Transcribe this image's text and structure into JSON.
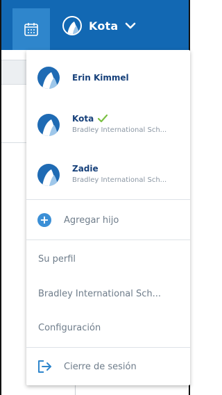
{
  "topbar": {
    "calendar_icon": "calendar-icon",
    "current_child": "Kota",
    "dropdown_icon": "chevron-down-icon"
  },
  "menu": {
    "children": [
      {
        "name": "Erin Kimmel",
        "school": "",
        "selected": false
      },
      {
        "name": "Kota",
        "school": "Bradley International Sch...",
        "selected": true
      },
      {
        "name": "Zadie",
        "school": "Bradley International Sch...",
        "selected": false
      }
    ],
    "add_child_label": "Agregar hijo",
    "profile_label": "Su perfil",
    "school_label": "Bradley International Sch...",
    "settings_label": "Configuración",
    "logout_label": "Cierre de sesión"
  },
  "colors": {
    "topbar": "#1268b3",
    "calendar_button": "#2f86cc",
    "accent": "#3b8fd6",
    "check": "#7bc043",
    "name_text": "#16407a",
    "muted_text": "#6e7c8a"
  }
}
